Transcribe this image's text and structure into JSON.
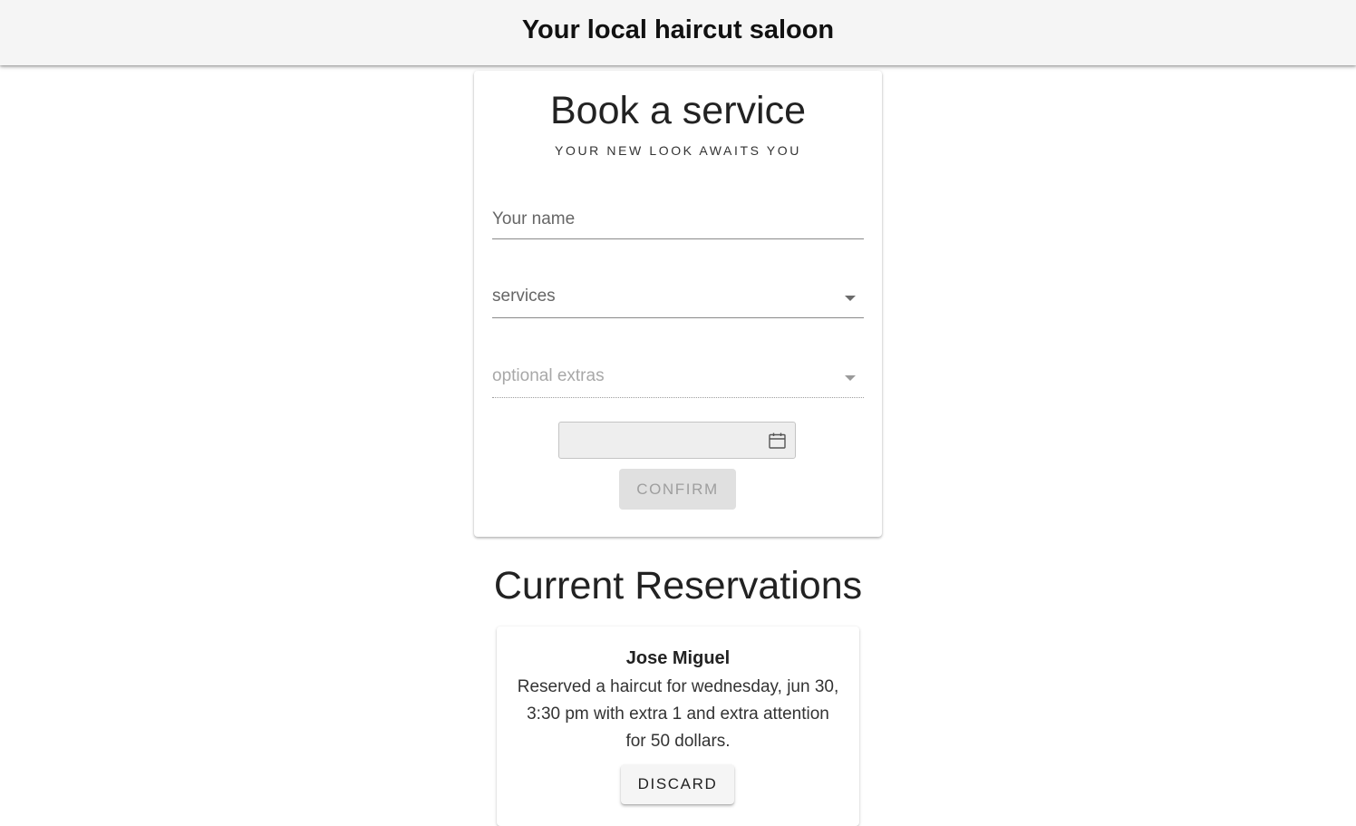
{
  "header": {
    "title": "Your local haircut saloon"
  },
  "booking": {
    "title": "Book a service",
    "subtitle": "YOUR NEW LOOK AWAITS YOU",
    "name_field": {
      "placeholder": "Your name",
      "value": ""
    },
    "services_field": {
      "label": "services",
      "value": ""
    },
    "extras_field": {
      "label": "optional extras",
      "value": "",
      "disabled": true
    },
    "date_field": {
      "value": "",
      "icon": "calendar-icon"
    },
    "confirm_label": "CONFIRM"
  },
  "reservations": {
    "title": "Current Reservations",
    "items": [
      {
        "name": "Jose Miguel",
        "description": "Reserved a haircut for wednesday, jun 30, 3:30 pm with extra 1 and extra attention for 50 dollars.",
        "discard_label": "DISCARD"
      }
    ]
  },
  "colors": {
    "app_bar_bg": "#f5f5f5",
    "disabled_button_bg": "#e0e0e0",
    "disabled_text": "#9e9e9e"
  }
}
